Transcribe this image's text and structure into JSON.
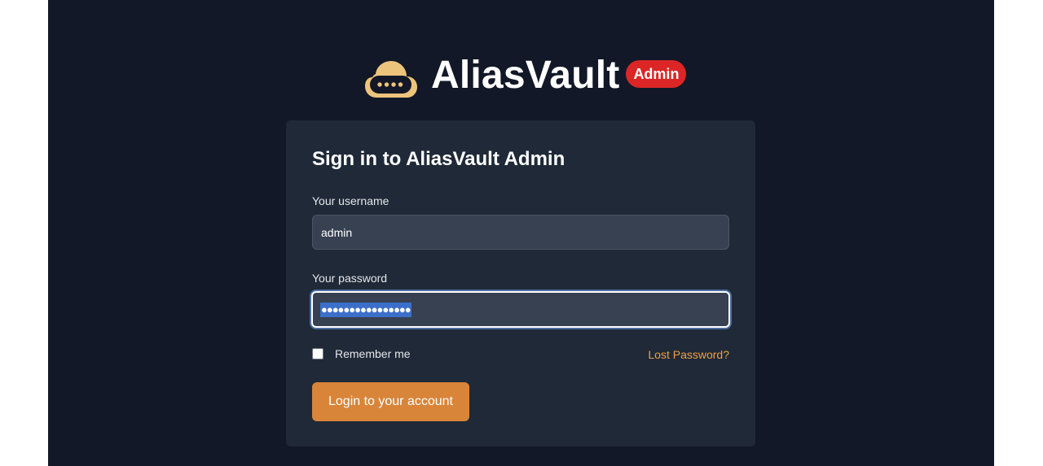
{
  "brand": {
    "name": "AliasVault",
    "badge": "Admin"
  },
  "login": {
    "title": "Sign in to AliasVault Admin",
    "username_label": "Your username",
    "username_value": "admin",
    "password_label": "Your password",
    "password_masked": "●●●●●●●●●●●●●●●●",
    "remember_label": "Remember me",
    "remember_checked": false,
    "lost_password": "Lost Password?",
    "submit": "Login to your account"
  },
  "colors": {
    "background": "#121827",
    "card": "#1f2937",
    "accent": "#d8853a",
    "link": "#f59e3b",
    "badge": "#dc2626"
  },
  "icons": {
    "logo": "cloud-keypad-icon"
  }
}
